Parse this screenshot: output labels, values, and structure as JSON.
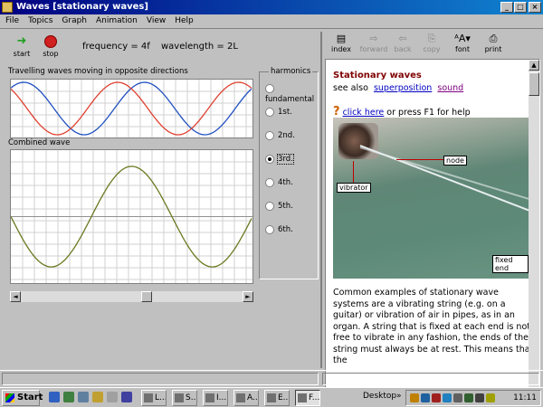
{
  "window": {
    "title": "Waves [stationary waves]",
    "controls": {
      "minimize": "_",
      "maximize": "□",
      "close": "×"
    }
  },
  "menu": [
    "File",
    "Topics",
    "Graph",
    "Animation",
    "View",
    "Help"
  ],
  "toolbar": {
    "start_label": "start",
    "stop_label": "stop",
    "frequency": "frequency = 4f",
    "wavelength": "wavelength = 2L"
  },
  "travelling": {
    "label": "Travelling waves moving in opposite directions",
    "series": [
      {
        "color": "#2050c0",
        "cycles": 2.0,
        "phase": 0.9
      },
      {
        "color": "#e04030",
        "cycles": 2.0,
        "phase": 2.3
      }
    ]
  },
  "combined": {
    "label": "Combined wave",
    "color": "#6a7a20",
    "cycles": 1.5,
    "amplitude": 0.8
  },
  "harmonics": {
    "legend": "harmonics",
    "options": [
      "fundamental",
      "1st.",
      "2nd.",
      "3rd.",
      "4th.",
      "5th.",
      "6th."
    ],
    "selected": "3rd."
  },
  "scroll": {
    "left_arrow": "◄",
    "right_arrow": "►",
    "up_arrow": "▲",
    "down_arrow": "▼",
    "position": 0.57
  },
  "help_toolbar": [
    {
      "label": "index",
      "icon": "index-icon",
      "glyph": "▤",
      "enabled": true
    },
    {
      "label": "forward",
      "icon": "forward-icon",
      "glyph": "⇨",
      "enabled": false
    },
    {
      "label": "back",
      "icon": "back-icon",
      "glyph": "⇦",
      "enabled": false
    },
    {
      "label": "copy",
      "icon": "copy-icon",
      "glyph": "⎘",
      "enabled": false
    },
    {
      "label": "font",
      "icon": "font-icon",
      "glyph": "ᴬA▾",
      "enabled": true
    },
    {
      "label": "print",
      "icon": "print-icon",
      "glyph": "⎙",
      "enabled": true
    }
  ],
  "help": {
    "heading": "Stationary waves",
    "see_also": "see also",
    "link_superposition": "superposition",
    "link_sound": "sound",
    "click_here": "click here",
    "press_f1": "or press F1 for help",
    "photo_labels": {
      "vibrator": "vibrator",
      "node": "node",
      "fixed_end": "fixed end"
    },
    "paragraph": "Common examples of stationary wave systems are a vibrating string (e.g. on a guitar) or vibration of air in pipes, as in an organ. A string that is fixed at each end is not free to vibrate in any fashion, the ends of the string must always be at rest. This means that the"
  },
  "taskbar": {
    "start": "Start",
    "tasks": [
      "L...",
      "S...",
      "I...",
      "A...",
      "E...",
      "F..."
    ],
    "desktop": "Desktop",
    "arrows": "»",
    "time": "11:11"
  }
}
